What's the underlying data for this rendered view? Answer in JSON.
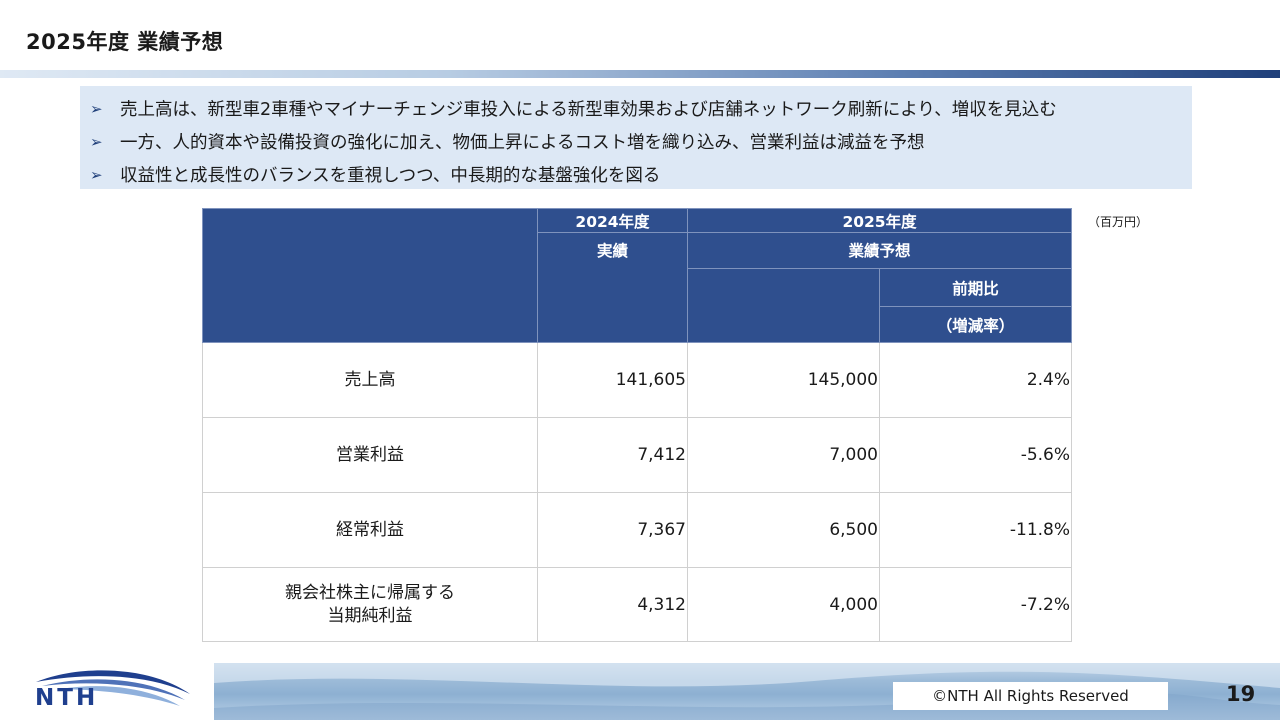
{
  "header": {
    "title": "2025年度 業績予想"
  },
  "bullets": [
    "売上高は、新型車2車種やマイナーチェンジ車投入による新型車効果および店舗ネットワーク刷新により、増収を見込む",
    "一方、人的資本や設備投資の強化に加え、物価上昇によるコスト増を織り込み、営業利益は減益を予想",
    "収益性と成長性のバランスを重視しつつ、中長期的な基盤強化を図る"
  ],
  "bullet_marker": "➢",
  "unit": "（百万円）",
  "table": {
    "headers": {
      "fy2024": "2024年度",
      "actual": "実績",
      "fy2025": "2025年度",
      "forecast": "業績予想",
      "yoy": "前期比",
      "yoy_sub": "（増減率）"
    },
    "rows": [
      {
        "label_line1": "売上高",
        "label_line2": "",
        "actual": "141,605",
        "forecast": "145,000",
        "yoy": "2.4%"
      },
      {
        "label_line1": "営業利益",
        "label_line2": "",
        "actual": "7,412",
        "forecast": "7,000",
        "yoy": "-5.6%"
      },
      {
        "label_line1": "経常利益",
        "label_line2": "",
        "actual": "7,367",
        "forecast": "6,500",
        "yoy": "-11.8%"
      },
      {
        "label_line1": "親会社株主に帰属する",
        "label_line2": "当期純利益",
        "actual": "4,312",
        "forecast": "4,000",
        "yoy": "-7.2%"
      }
    ]
  },
  "footer": {
    "logo_text": "NTH",
    "copyright": "©NTH All Rights Reserved",
    "page_number": "19"
  },
  "colors": {
    "header_fill": "#2f4f8e",
    "bullet_box": "#dde8f5",
    "accent_dark": "#1f3f7a"
  }
}
